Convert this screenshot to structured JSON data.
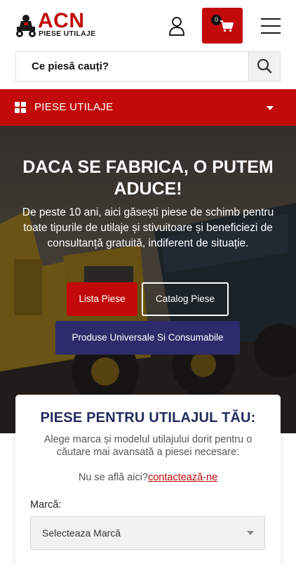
{
  "header": {
    "logo_brand": "ACN",
    "logo_subtitle": "PIESE UTILAJE",
    "cart_count": "0",
    "icons": {
      "user": "user-icon",
      "cart": "cart-icon",
      "menu": "menu-icon"
    }
  },
  "search": {
    "placeholder": "Ce piesă cauți?",
    "icon": "search-icon"
  },
  "category_bar": {
    "label": "PIESE UTILAJE",
    "icon": "grid-icon"
  },
  "hero": {
    "title": "DACA SE FABRICA, O PUTEM ADUCE!",
    "text": "De peste 10 ani, aici găsești piese de schimb pentru toate tipurile de utilaje și stivuitoare și beneficiezi de consultanță gratuită, indiferent de situație.",
    "buttons": {
      "lista": "Lista Piese",
      "catalog": "Catalog Piese",
      "universal": "Produse Universale Si Consumabile"
    }
  },
  "finder": {
    "title": "PIESE PENTRU UTILAJUL TĂU:",
    "description": "Alege marca și modelul utilajului dorit pentru o căutare mai avansată a piesei necesare:",
    "missing_prefix": "Nu se află aici?",
    "missing_link": "contactează-ne",
    "brand_label": "Marcă:",
    "brand_select_value": "Selecteaza Marcă"
  },
  "colors": {
    "brand_red": "#c20a0a",
    "navy": "#232a5c",
    "button_indigo": "#2d2b6b"
  }
}
